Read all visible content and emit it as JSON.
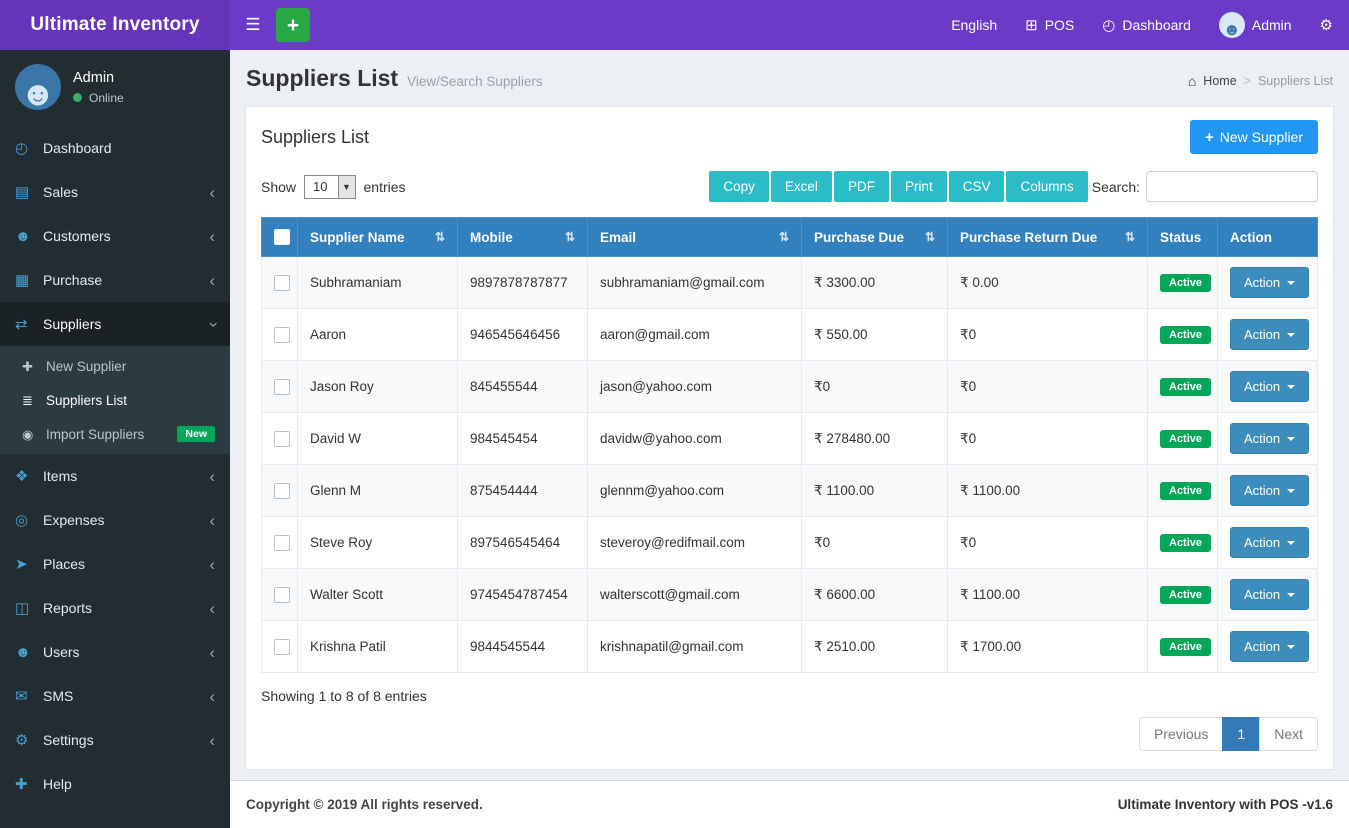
{
  "navbar": {
    "brand": "Ultimate Inventory",
    "language": "English",
    "pos_label": "POS",
    "dashboard_label": "Dashboard",
    "user_label": "Admin"
  },
  "sidebar": {
    "user": {
      "name": "Admin",
      "status": "Online"
    },
    "items": [
      {
        "label": "Dashboard",
        "icon": "dashboard-icon"
      },
      {
        "label": "Sales",
        "icon": "sales-icon",
        "chevron": "left"
      },
      {
        "label": "Customers",
        "icon": "customers-icon",
        "chevron": "left"
      },
      {
        "label": "Purchase",
        "icon": "purchase-icon",
        "chevron": "left"
      },
      {
        "label": "Suppliers",
        "icon": "suppliers-icon",
        "chevron": "down",
        "active": true,
        "submenu": [
          {
            "label": "New Supplier",
            "icon": "new-supplier-icon"
          },
          {
            "label": "Suppliers List",
            "icon": "suppliers-list-icon",
            "active": true
          },
          {
            "label": "Import Suppliers",
            "icon": "import-suppliers-icon",
            "badge": "New"
          }
        ]
      },
      {
        "label": "Items",
        "icon": "items-icon",
        "chevron": "left"
      },
      {
        "label": "Expenses",
        "icon": "expenses-icon",
        "chevron": "left"
      },
      {
        "label": "Places",
        "icon": "places-icon",
        "chevron": "left"
      },
      {
        "label": "Reports",
        "icon": "reports-icon",
        "chevron": "left"
      },
      {
        "label": "Users",
        "icon": "users-icon",
        "chevron": "left"
      },
      {
        "label": "SMS",
        "icon": "sms-icon",
        "chevron": "left"
      },
      {
        "label": "Settings",
        "icon": "settings-icon",
        "chevron": "left"
      },
      {
        "label": "Help",
        "icon": "help-icon"
      }
    ]
  },
  "content": {
    "page_title": "Suppliers List",
    "page_subtitle": "View/Search Suppliers",
    "breadcrumb": {
      "home": "Home",
      "current": "Suppliers List"
    },
    "card": {
      "title": "Suppliers List",
      "new_supplier_button": "New Supplier",
      "show_label": "Show",
      "entries_label": "entries",
      "page_length": "10",
      "export_buttons": [
        "Copy",
        "Excel",
        "PDF",
        "Print",
        "CSV",
        "Columns"
      ],
      "search_label": "Search:",
      "search_value": "",
      "table": {
        "headers": [
          {
            "label": "Supplier Name",
            "sortable": true
          },
          {
            "label": "Mobile",
            "sortable": true
          },
          {
            "label": "Email",
            "sortable": true
          },
          {
            "label": "Purchase Due",
            "sortable": true
          },
          {
            "label": "Purchase Return Due",
            "sortable": true
          },
          {
            "label": "Status",
            "sortable": false
          },
          {
            "label": "Action",
            "sortable": false
          }
        ],
        "rows": [
          {
            "name": "Subhramaniam",
            "mobile": "9897878787877",
            "email": "subhramaniam@gmail.com",
            "purchase_due": "₹ 3300.00",
            "purchase_return_due": "₹ 0.00",
            "status": "Active",
            "action": "Action"
          },
          {
            "name": "Aaron",
            "mobile": "946545646456",
            "email": "aaron@gmail.com",
            "purchase_due": "₹ 550.00",
            "purchase_return_due": "₹0",
            "status": "Active",
            "action": "Action"
          },
          {
            "name": "Jason Roy",
            "mobile": "845455544",
            "email": "jason@yahoo.com",
            "purchase_due": "₹0",
            "purchase_return_due": "₹0",
            "status": "Active",
            "action": "Action"
          },
          {
            "name": "David W",
            "mobile": "984545454",
            "email": "davidw@yahoo.com",
            "purchase_due": "₹ 278480.00",
            "purchase_return_due": "₹0",
            "status": "Active",
            "action": "Action"
          },
          {
            "name": "Glenn M",
            "mobile": "875454444",
            "email": "glennm@yahoo.com",
            "purchase_due": "₹ 1100.00",
            "purchase_return_due": "₹ 1100.00",
            "status": "Active",
            "action": "Action"
          },
          {
            "name": "Steve Roy",
            "mobile": "897546545464",
            "email": "steveroy@redifmail.com",
            "purchase_due": "₹0",
            "purchase_return_due": "₹0",
            "status": "Active",
            "action": "Action"
          },
          {
            "name": "Walter Scott",
            "mobile": "9745454787454",
            "email": "walterscott@gmail.com",
            "purchase_due": "₹ 6600.00",
            "purchase_return_due": "₹ 1100.00",
            "status": "Active",
            "action": "Action"
          },
          {
            "name": "Krishna Patil",
            "mobile": "9844545544",
            "email": "krishnapatil@gmail.com",
            "purchase_due": "₹ 2510.00",
            "purchase_return_due": "₹ 1700.00",
            "status": "Active",
            "action": "Action"
          }
        ]
      },
      "showing_text": "Showing 1 to 8 of 8 entries",
      "pagination": {
        "previous": "Previous",
        "page": "1",
        "next": "Next"
      }
    }
  },
  "footer": {
    "copyright": "Copyright © 2019 All rights reserved.",
    "version": "Ultimate Inventory with POS -v1.6"
  }
}
